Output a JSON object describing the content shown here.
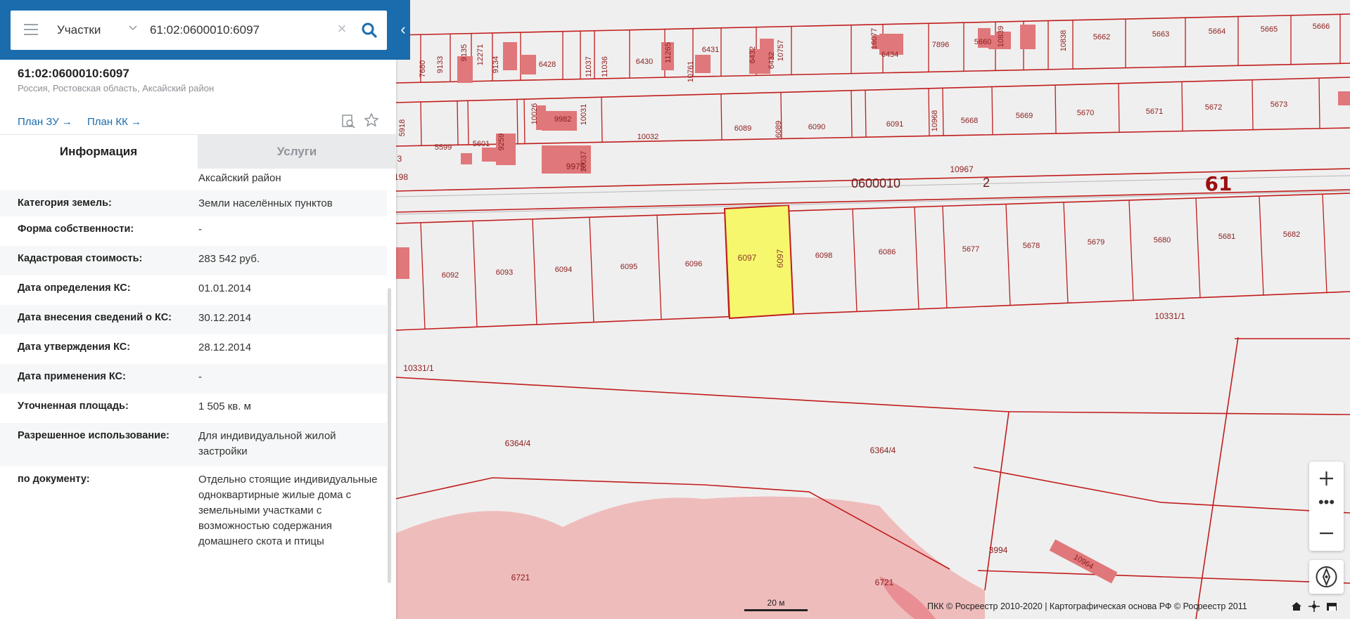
{
  "search": {
    "type_label": "Участки",
    "value": "61:02:0600010:6097"
  },
  "object": {
    "title": "61:02:0600010:6097",
    "address": "Россия, Ростовская область, Аксайский район",
    "plan_zu": "План ЗУ →",
    "plan_kk": "План КК →"
  },
  "tabs": {
    "info": "Информация",
    "services": "Услуги"
  },
  "info": {
    "partial_value": "Аксайский район",
    "rows": [
      {
        "key": "Категория земель:",
        "value": "Земли населённых пунктов"
      },
      {
        "key": "Форма собственности:",
        "value": "-"
      },
      {
        "key": "Кадастровая стоимость:",
        "value": "283 542 руб."
      },
      {
        "key": "Дата определения КС:",
        "value": "01.01.2014"
      },
      {
        "key": "Дата внесения сведений о КС:",
        "value": "30.12.2014"
      },
      {
        "key": "Дата утверждения КС:",
        "value": "28.12.2014"
      },
      {
        "key": "Дата применения КС:",
        "value": "-"
      },
      {
        "key": "Уточненная площадь:",
        "value": "1 505 кв. м"
      },
      {
        "key": "Разрешенное использование:",
        "value": "Для индивидуальной жилой застройки"
      },
      {
        "key": "по документу:",
        "value": "Отдельно стоящие индивидуальные одноквартирные жилые дома с земельными участками с возможностью содержания домашнего скота и птицы"
      }
    ]
  },
  "map": {
    "highlight_color": "#f7f76e",
    "line_color": "#c01d1d",
    "building_color": "#e0777a",
    "zone_color": "#efbcbc",
    "labels": {
      "top_row": [
        "7680",
        "9133",
        "9135",
        "12271",
        "9134",
        "6428",
        "11037",
        "11036",
        "6430",
        "11265",
        "10761",
        "6431",
        "6432",
        "10757",
        "6432",
        "6434",
        "16077",
        "7896",
        "5660",
        "10839",
        "10838",
        "5662",
        "5663",
        "5664",
        "5665",
        "5666"
      ],
      "second_row": [
        "5918",
        "5599",
        "5601",
        "9259",
        "10026",
        "9982",
        "10031",
        "10032",
        "6089",
        "6089",
        "6090",
        "6091",
        "10968",
        "5668",
        "5669",
        "5670",
        "5671",
        "5672",
        "5673"
      ],
      "misc": [
        "9975",
        "10037",
        "0600010",
        "2",
        "61",
        "10967",
        "3",
        "198"
      ],
      "lower_row": [
        "6092",
        "6093",
        "6094",
        "6095",
        "6096",
        "6097",
        "6097",
        "6098",
        "6086",
        "5677",
        "5678",
        "5679",
        "5680",
        "5681",
        "5682"
      ],
      "big": [
        "10331/1",
        "10331/1",
        "6364/4",
        "6364/4",
        "3994",
        "10964",
        "6721",
        "6721"
      ]
    },
    "scale": "20 м",
    "copyright": "ПКК © Росреестр 2010-2020 | Картографическая основа РФ © Росреестр 2011"
  }
}
